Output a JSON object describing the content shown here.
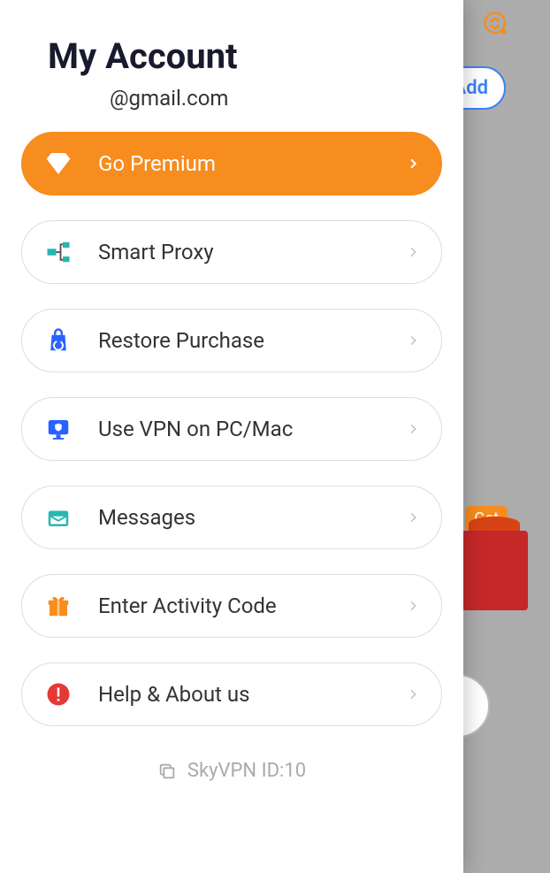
{
  "header": {
    "title": "My Account",
    "email": "@gmail.com"
  },
  "menu": {
    "go_premium": "Go Premium",
    "smart_proxy": "Smart Proxy",
    "restore_purchase": "Restore Purchase",
    "use_vpn_pc_mac": "Use VPN on PC/Mac",
    "messages": "Messages",
    "enter_activity_code": "Enter Activity Code",
    "help_about": "Help & About us"
  },
  "footer": {
    "id_label": "SkyVPN ID:10"
  },
  "background": {
    "add_label": "Add",
    "get_label": "Get"
  },
  "colors": {
    "accent": "#f78c1f",
    "blue": "#3b82f6",
    "red": "#e53935",
    "teal": "#29b6b0"
  }
}
